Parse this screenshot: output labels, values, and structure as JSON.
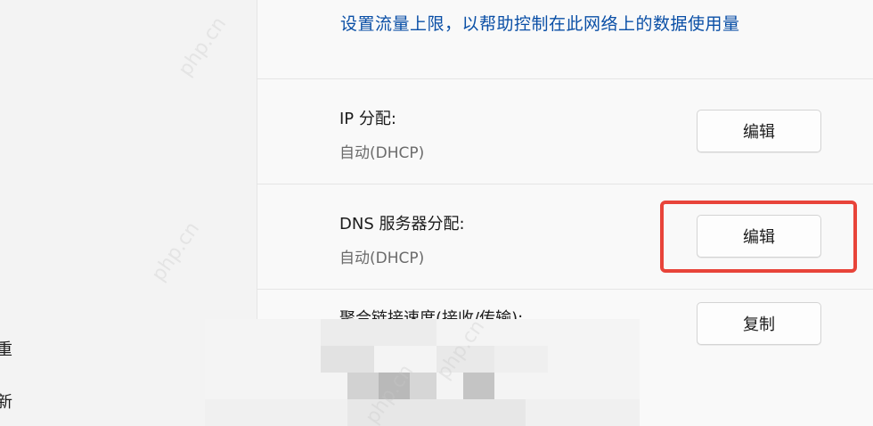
{
  "left_pane": {
    "char_1": "重",
    "char_2": "新"
  },
  "data_limit_link": "设置流量上限，以帮助控制在此网络上的数据使用量",
  "ip_assignment": {
    "label": "IP 分配:",
    "value": "自动(DHCP)",
    "button": "编辑"
  },
  "dns_assignment": {
    "label": "DNS 服务器分配:",
    "value": "自动(DHCP)",
    "button": "编辑"
  },
  "link_speed": {
    "label": "聚合链接速度(接收/传输):",
    "button": "复制"
  },
  "highlight_color": "#e8443a",
  "watermark_text": "php.cn"
}
